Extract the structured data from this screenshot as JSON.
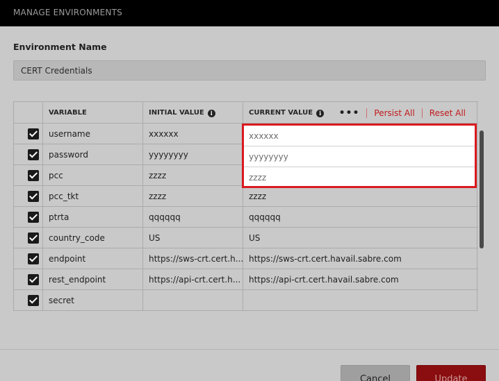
{
  "window": {
    "title": "MANAGE ENVIRONMENTS"
  },
  "environment": {
    "label": "Environment Name",
    "value": "CERT Credentials"
  },
  "table": {
    "headers": {
      "variable": "VARIABLE",
      "initial": "INITIAL VALUE",
      "current": "CURRENT VALUE"
    },
    "actions": {
      "more": "•••",
      "persist_all": "Persist All",
      "reset_all": "Reset All"
    },
    "info_icon": "i",
    "rows": [
      {
        "checked": true,
        "variable": "username",
        "initial": "xxxxxx",
        "current": "xxxxxx"
      },
      {
        "checked": true,
        "variable": "password",
        "initial": "yyyyyyyy",
        "current": "yyyyyyyy"
      },
      {
        "checked": true,
        "variable": "pcc",
        "initial": "zzzz",
        "current": "zzzz"
      },
      {
        "checked": true,
        "variable": "pcc_tkt",
        "initial": "zzzz",
        "current": "zzzz"
      },
      {
        "checked": true,
        "variable": "ptrta",
        "initial": "qqqqqq",
        "current": "qqqqqq"
      },
      {
        "checked": true,
        "variable": "country_code",
        "initial": "US",
        "current": "US"
      },
      {
        "checked": true,
        "variable": "endpoint",
        "initial": "https://sws-crt.cert.h...",
        "current": "https://sws-crt.cert.havail.sabre.com"
      },
      {
        "checked": true,
        "variable": "rest_endpoint",
        "initial": "https://api-crt.cert.h...",
        "current": "https://api-crt.cert.havail.sabre.com"
      },
      {
        "checked": true,
        "variable": "secret",
        "initial": "",
        "current": ""
      }
    ]
  },
  "buttons": {
    "cancel": "Cancel",
    "update": "Update"
  },
  "colors": {
    "accent": "#c0191b",
    "highlight_border": "#d9191f",
    "titlebar": "#000000"
  }
}
